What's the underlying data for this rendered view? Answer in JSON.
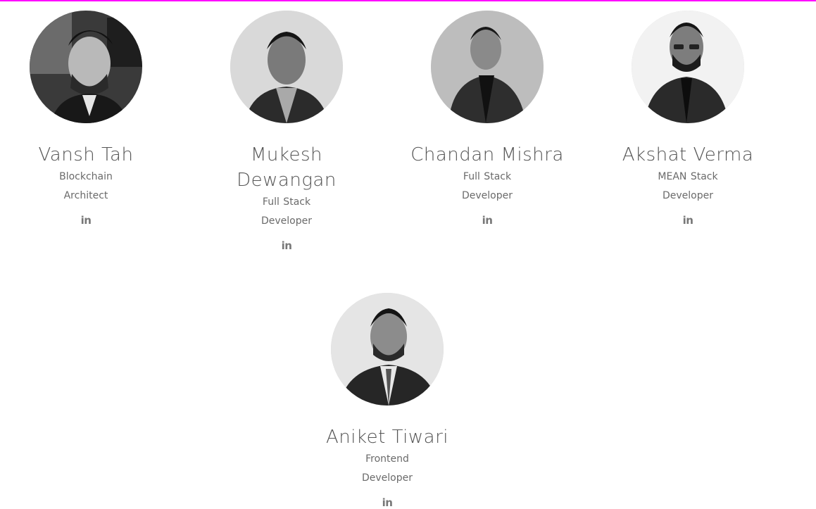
{
  "team": [
    {
      "name": "Vansh Tah",
      "role": "Blockchain Architect",
      "social_icon": "linkedin-icon",
      "social_label": "in"
    },
    {
      "name": "Mukesh Dewangan",
      "role": "Full Stack Developer",
      "social_icon": "linkedin-icon",
      "social_label": "in"
    },
    {
      "name": "Chandan Mishra",
      "role": "Full Stack Developer",
      "social_icon": "linkedin-icon",
      "social_label": "in"
    },
    {
      "name": "Akshat Verma",
      "role": "MEAN Stack Developer",
      "social_icon": "linkedin-icon",
      "social_label": "in"
    },
    {
      "name": "Aniket Tiwari",
      "role": "Frontend Developer",
      "social_icon": "linkedin-icon",
      "social_label": "in"
    }
  ],
  "colors": {
    "accent_bar": "#ff00ff",
    "text": "#555555"
  }
}
